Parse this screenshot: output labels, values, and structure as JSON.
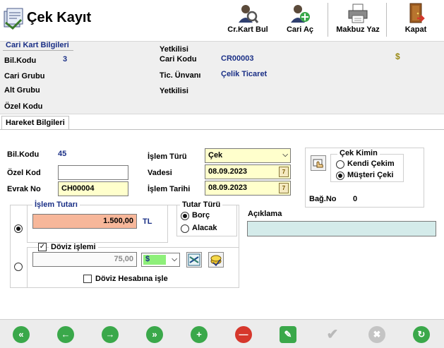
{
  "window": {
    "title": "Çek Kayıt"
  },
  "toolbar": {
    "items": [
      {
        "label": "Cr.Kart Bul",
        "icon": "user-search-icon"
      },
      {
        "label": "Cari Aç",
        "icon": "user-add-icon"
      },
      {
        "label": "Makbuz Yaz",
        "icon": "printer-icon"
      },
      {
        "label": "Kapat",
        "icon": "exit-door-icon"
      }
    ]
  },
  "cari_kart": {
    "section_title": "Cari Kart Bilgileri",
    "bil_kodu_label": "Bil.Kodu",
    "bil_kodu_value": "3",
    "cari_grubu_label": "Cari Grubu",
    "alt_grubu_label": "Alt Grubu",
    "ozel_kodu_label": "Özel Kodu",
    "yetkilisi_top_label": "Yetkilisi",
    "cari_kodu_label": "Cari Kodu",
    "cari_kodu_value": "CR00003",
    "tic_unvani_label": "Tic. Ünvanı",
    "tic_unvani_value": "Çelik Ticaret",
    "yetkilisi_label": "Yetkilisi",
    "currency_symbol": "$"
  },
  "tabs": [
    {
      "label": "Hareket Bilgileri",
      "active": true
    }
  ],
  "hareket": {
    "bil_kodu_label": "Bil.Kodu",
    "bil_kodu_value": "45",
    "ozel_kod_label": "Özel Kod",
    "ozel_kod_value": "",
    "evrak_no_label": "Evrak No",
    "evrak_no_value": "CH00004",
    "islem_turu_label": "İşlem Türü",
    "islem_turu_value": "Çek",
    "vadesi_label": "Vadesi",
    "vadesi_value": "08.09.2023",
    "islem_tarihi_label": "İşlem Tarihi",
    "islem_tarihi_value": "08.09.2023",
    "cek_kimin": {
      "title": "Çek Kimin",
      "options": [
        "Kendi Çekim",
        "Müşteri Çeki"
      ],
      "selected": "Müşteri Çeki"
    },
    "bag_no_label": "Bağ.No",
    "bag_no_value": "0",
    "islem_tutari": {
      "title": "İşlem Tutarı",
      "value": "1.500,00",
      "currency": "TL"
    },
    "tutar_turu": {
      "title": "Tutar Türü",
      "options": [
        "Borç",
        "Alacak"
      ],
      "selected": "Borç"
    },
    "aciklama_label": "Açıklama",
    "aciklama_value": "",
    "doviz": {
      "checkbox_label": "Döviz işlemi",
      "checked": true,
      "amount": "75,00",
      "currency": "$",
      "hesap_checkbox_label": "Döviz Hesabına işle",
      "hesap_checked": false
    }
  },
  "navbar": {
    "buttons": [
      {
        "icon": "first-record-icon",
        "color": "#3aa84a"
      },
      {
        "icon": "previous-record-icon",
        "color": "#3aa84a"
      },
      {
        "icon": "next-record-icon",
        "color": "#3aa84a"
      },
      {
        "icon": "last-record-icon",
        "color": "#3aa84a"
      },
      {
        "icon": "add-record-icon",
        "color": "#3aa84a"
      },
      {
        "icon": "delete-record-icon",
        "color": "#d6372c"
      },
      {
        "icon": "edit-record-icon",
        "color": "#3aa84a"
      },
      {
        "icon": "save-check-icon",
        "color": "#b9b9b9"
      },
      {
        "icon": "cancel-x-icon",
        "color": "#b9b9b9"
      },
      {
        "icon": "refresh-icon",
        "color": "#3aa84a"
      }
    ]
  }
}
